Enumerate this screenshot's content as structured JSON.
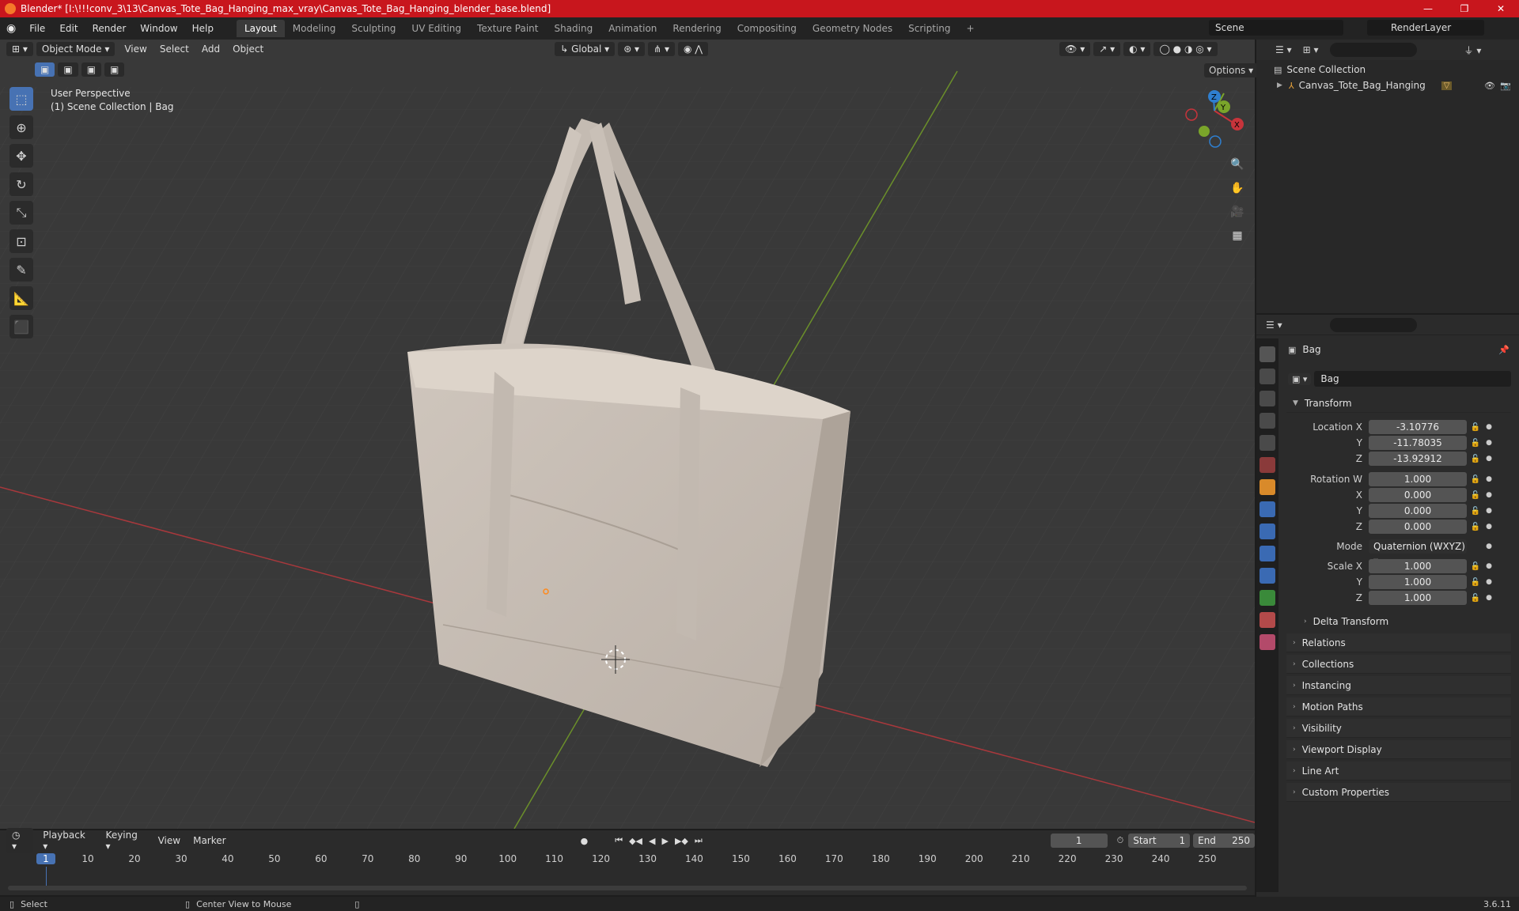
{
  "titlebar": {
    "title": "Blender* [I:\\!!!conv_3\\13\\Canvas_Tote_Bag_Hanging_max_vray\\Canvas_Tote_Bag_Hanging_blender_base.blend]",
    "minimize": "—",
    "maximize": "❐",
    "close": "✕"
  },
  "menu": [
    "File",
    "Edit",
    "Render",
    "Window",
    "Help"
  ],
  "workspaces": [
    "Layout",
    "Modeling",
    "Sculpting",
    "UV Editing",
    "Texture Paint",
    "Shading",
    "Animation",
    "Rendering",
    "Compositing",
    "Geometry Nodes",
    "Scripting"
  ],
  "workspace_add": "+",
  "scene": {
    "label": "Scene",
    "renderlayer": "RenderLayer"
  },
  "viewport": {
    "mode": "Object Mode",
    "menus": [
      "View",
      "Select",
      "Add",
      "Object"
    ],
    "orientation": "Global",
    "options": "Options",
    "perspective": "User Perspective",
    "context": "(1) Scene Collection | Bag"
  },
  "gizmo": {
    "x": "X",
    "y": "Y",
    "z": "Z"
  },
  "outliner": {
    "root": "Scene Collection",
    "item": "Canvas_Tote_Bag_Hanging"
  },
  "properties": {
    "object_name": "Bag",
    "data_name": "Bag",
    "transform_header": "Transform",
    "location_label": "Location X",
    "location": [
      "-3.10776",
      "-11.78035",
      "-13.92912"
    ],
    "rotation_label": "Rotation W",
    "rotation": [
      "1.000",
      "0.000",
      "0.000",
      "0.000"
    ],
    "axis_labels": [
      "X",
      "Y",
      "Z"
    ],
    "mode_label": "Mode",
    "mode_value": "Quaternion (WXYZ)",
    "scale_label": "Scale X",
    "scale": [
      "1.000",
      "1.000",
      "1.000"
    ],
    "delta": "Delta Transform",
    "sections": [
      "Relations",
      "Collections",
      "Instancing",
      "Motion Paths",
      "Visibility",
      "Viewport Display",
      "Line Art",
      "Custom Properties"
    ]
  },
  "timeline": {
    "menus": [
      "Playback",
      "Keying",
      "View",
      "Marker"
    ],
    "current_frame": "1",
    "start_label": "Start",
    "start": "1",
    "end_label": "End",
    "end": "250",
    "ticks": [
      "1",
      "10",
      "20",
      "30",
      "40",
      "50",
      "60",
      "70",
      "80",
      "90",
      "100",
      "110",
      "120",
      "130",
      "140",
      "150",
      "160",
      "170",
      "180",
      "190",
      "200",
      "210",
      "220",
      "230",
      "240",
      "250"
    ]
  },
  "status": {
    "select": "Select",
    "center": "Center View to Mouse",
    "version": "3.6.11"
  },
  "colors": {
    "accent": "#4772b3",
    "titlebar": "#c8161d",
    "x_axis": "#c7343b",
    "y_axis": "#7aa52a",
    "z_axis": "#2f7fd0"
  }
}
